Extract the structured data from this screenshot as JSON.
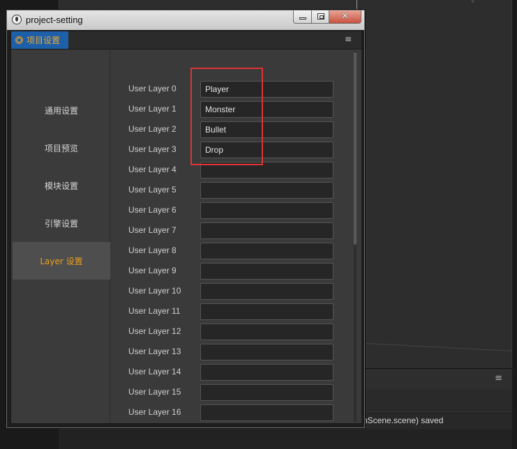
{
  "background": {
    "console_message": "nScene.scene) saved",
    "console_menu_icon": "hamburger-icon"
  },
  "window": {
    "title": "project-setting",
    "close_glyph": "✕"
  },
  "panel": {
    "tab_label": "项目设置",
    "tab_icon": "gear-icon",
    "menu_glyph": "≡"
  },
  "sidebar": {
    "items": [
      {
        "label": "通用设置",
        "active": false
      },
      {
        "label": "项目预览",
        "active": false
      },
      {
        "label": "模块设置",
        "active": false
      },
      {
        "label": "引擎设置",
        "active": false
      },
      {
        "label": "Layer 设置",
        "active": true
      }
    ]
  },
  "layers": [
    {
      "label": "User Layer 0",
      "value": "Player"
    },
    {
      "label": "User Layer 1",
      "value": "Monster"
    },
    {
      "label": "User Layer 2",
      "value": "Bullet"
    },
    {
      "label": "User Layer 3",
      "value": "Drop"
    },
    {
      "label": "User Layer 4",
      "value": ""
    },
    {
      "label": "User Layer 5",
      "value": ""
    },
    {
      "label": "User Layer 6",
      "value": ""
    },
    {
      "label": "User Layer 7",
      "value": ""
    },
    {
      "label": "User Layer 8",
      "value": ""
    },
    {
      "label": "User Layer 9",
      "value": ""
    },
    {
      "label": "User Layer 10",
      "value": ""
    },
    {
      "label": "User Layer 11",
      "value": ""
    },
    {
      "label": "User Layer 12",
      "value": ""
    },
    {
      "label": "User Layer 13",
      "value": ""
    },
    {
      "label": "User Layer 14",
      "value": ""
    },
    {
      "label": "User Layer 15",
      "value": ""
    },
    {
      "label": "User Layer 16",
      "value": ""
    }
  ],
  "colors": {
    "accent_tab": "#1d5fa8",
    "active_text": "#e9a020",
    "highlight_box": "#e03434"
  }
}
